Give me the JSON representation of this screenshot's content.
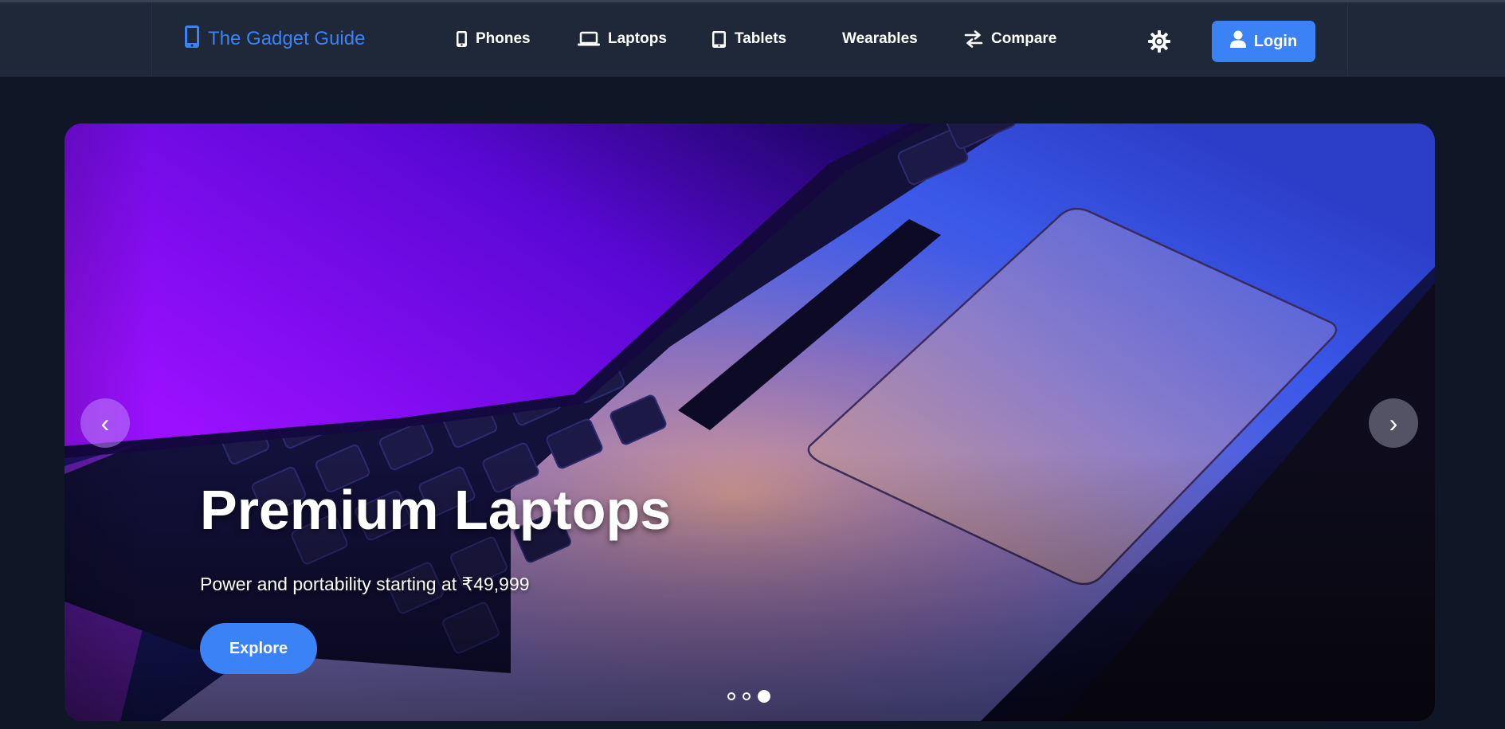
{
  "navbar": {
    "brand": {
      "label": "The Gadget Guide",
      "icon": "phone-icon"
    },
    "links": [
      {
        "label": "Phones",
        "icon": "phone-icon"
      },
      {
        "label": "Laptops",
        "icon": "laptop-icon"
      },
      {
        "label": "Tablets",
        "icon": "tablet-icon"
      },
      {
        "label": "Wearables",
        "icon": ""
      },
      {
        "label": "Compare",
        "icon": "compare-arrows-icon"
      }
    ],
    "theme_toggle_icon": "sun-icon",
    "login": {
      "label": "Login",
      "icon": "user-icon"
    }
  },
  "hero": {
    "title": "Premium Laptops",
    "subtitle": "Power and portability starting at ₹49,999",
    "cta_label": "Explore",
    "prev_arrow": "‹",
    "next_arrow": "›",
    "slide_count": 3,
    "active_slide": 3
  },
  "colors": {
    "accent": "#3b82f6",
    "navbar_bg": "#1e2838",
    "page_bg": "#0f1726"
  }
}
